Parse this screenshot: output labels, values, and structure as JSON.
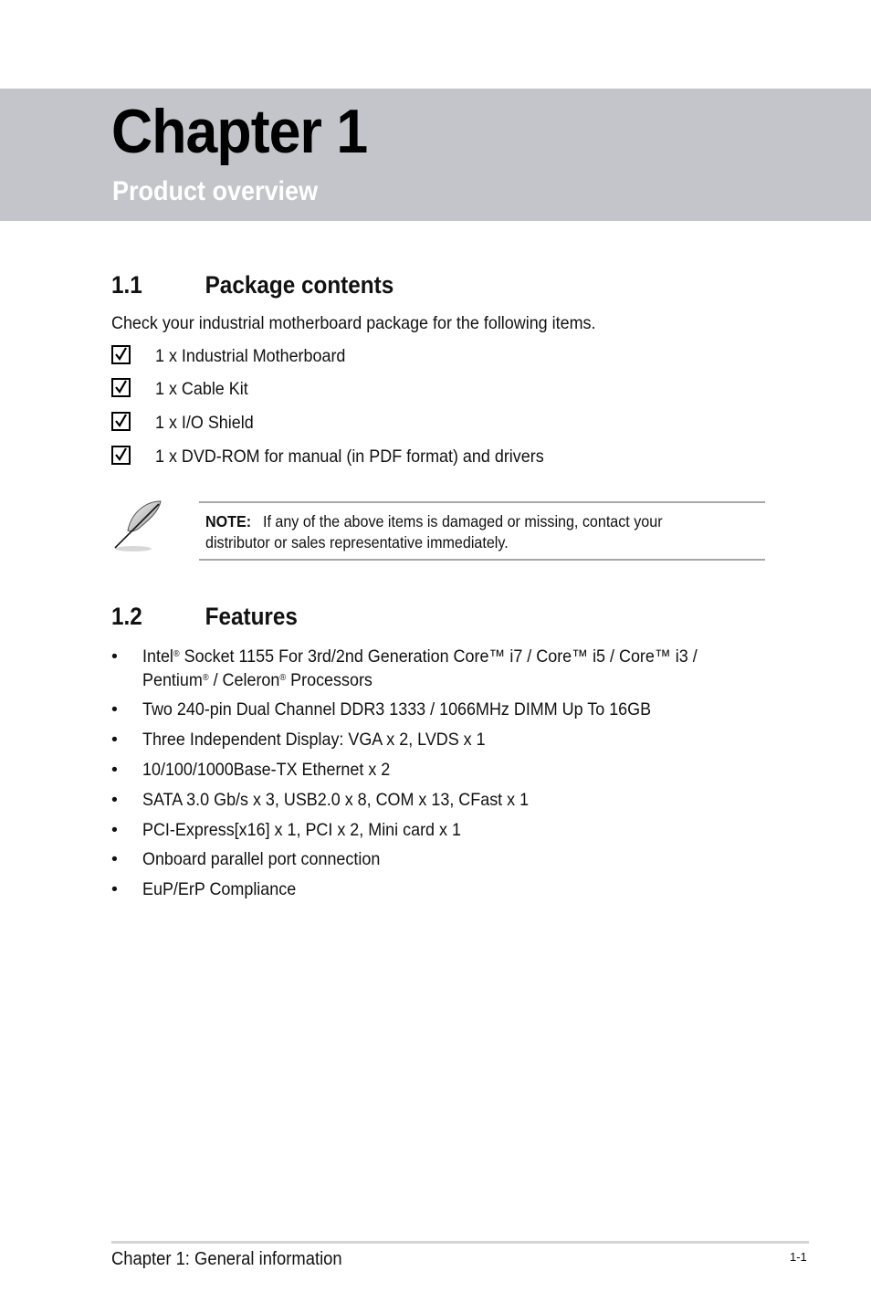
{
  "chapter": {
    "title": "Chapter 1",
    "subtitle": "Product overview"
  },
  "section_1_1": {
    "number": "1.1",
    "title": "Package contents",
    "intro": "Check your industrial motherboard package for the following items.",
    "items": [
      {
        "label": "1 x Industrial Motherboard",
        "checked": true
      },
      {
        "label": "1 x Cable Kit",
        "checked": true
      },
      {
        "label": "1 x I/O Shield",
        "checked": true
      },
      {
        "label": "1 x DVD-ROM for manual (in PDF format) and drivers",
        "checked": true
      }
    ]
  },
  "note": {
    "icon": "feather-pen-icon",
    "label": "NOTE:",
    "line1": "If any of the above items is damaged or missing, contact your",
    "line2": "distributor or sales representative immediately."
  },
  "section_1_2": {
    "number": "1.2",
    "title": "Features",
    "bullet_glyph": "•",
    "features": [
      {
        "line1_parts": [
          "Intel",
          "®",
          " Socket 1155 For 3rd/2nd Generation Core™ i7 / Core™ i5 / Core™ i3 /"
        ],
        "line2_parts": [
          "Pentium",
          "®",
          " / Celeron",
          "®",
          " Processors"
        ]
      },
      {
        "text": "Two 240-pin Dual Channel DDR3 1333 / 1066MHz DIMM Up To 16GB"
      },
      {
        "text": "Three Independent Display: VGA x 2, LVDS x 1"
      },
      {
        "text": "10/100/1000Base-TX Ethernet x 2"
      },
      {
        "text": "SATA 3.0 Gb/s x 3, USB2.0 x 8, COM x 13, CFast x 1"
      },
      {
        "text": "PCI-Express[x16] x 1, PCI x 2, Mini card x 1"
      },
      {
        "text": "Onboard parallel port connection"
      },
      {
        "text": "EuP/ErP Compliance"
      }
    ]
  },
  "footer": {
    "left": "Chapter 1: General information",
    "page": "1-1"
  }
}
